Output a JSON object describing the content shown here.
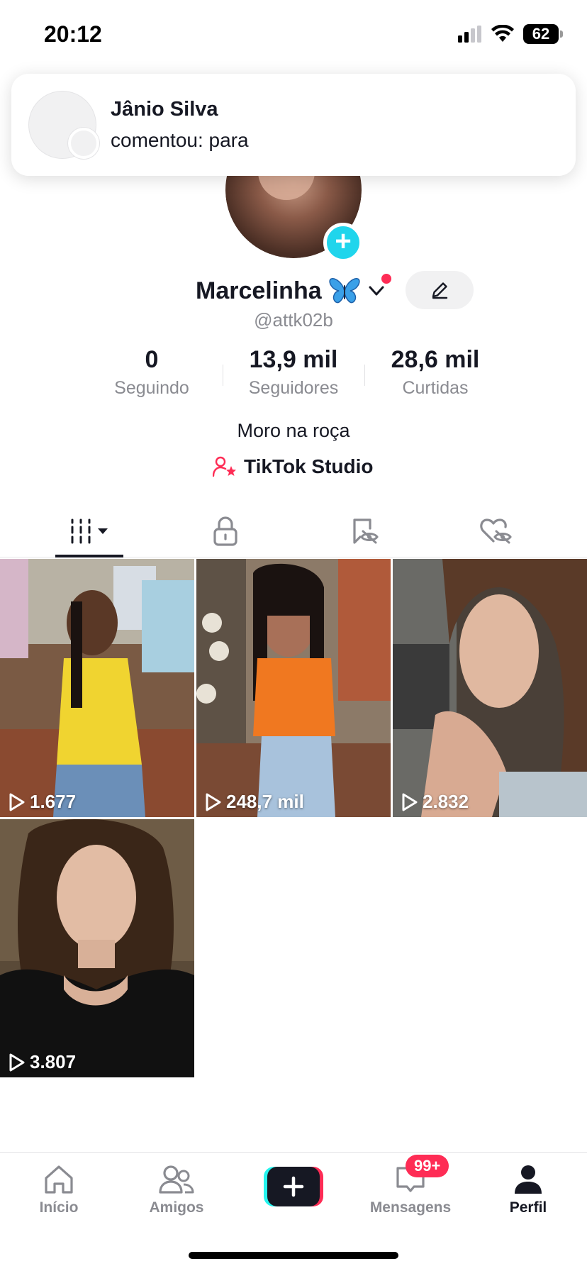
{
  "status_bar": {
    "time": "20:12",
    "battery": "62",
    "icons": [
      "signal-icon",
      "wifi-icon",
      "battery-icon"
    ]
  },
  "notification": {
    "title": "Jânio Silva",
    "body": "comentou: para"
  },
  "profile": {
    "name": "Marcelinha",
    "name_emoji": "butterfly",
    "handle": "@attk02b",
    "stats": [
      {
        "value": "0",
        "label": "Seguindo"
      },
      {
        "value": "13,9 mil",
        "label": "Seguidores"
      },
      {
        "value": "28,6 mil",
        "label": "Curtidas"
      }
    ],
    "bio": "Moro na roça",
    "studio_label": "TikTok Studio"
  },
  "tabs": [
    {
      "icon": "grid-icon",
      "active": true
    },
    {
      "icon": "lock-icon",
      "active": false
    },
    {
      "icon": "bookmark-hidden-icon",
      "active": false
    },
    {
      "icon": "heart-hidden-icon",
      "active": false
    }
  ],
  "videos": [
    {
      "views": "1.677"
    },
    {
      "views": "248,7 mil"
    },
    {
      "views": "2.832"
    },
    {
      "views": "3.807"
    }
  ],
  "bottom_nav": [
    {
      "label": "Início",
      "icon": "home-icon"
    },
    {
      "label": "Amigos",
      "icon": "friends-icon"
    },
    {
      "label": "",
      "icon": "create-icon"
    },
    {
      "label": "Mensagens",
      "icon": "inbox-icon",
      "badge": "99+"
    },
    {
      "label": "Perfil",
      "icon": "profile-icon",
      "active": true
    }
  ],
  "colors": {
    "accent_red": "#fe2c55",
    "accent_cyan": "#20d5ec",
    "text_primary": "#161823",
    "text_secondary": "#8a8b91"
  }
}
